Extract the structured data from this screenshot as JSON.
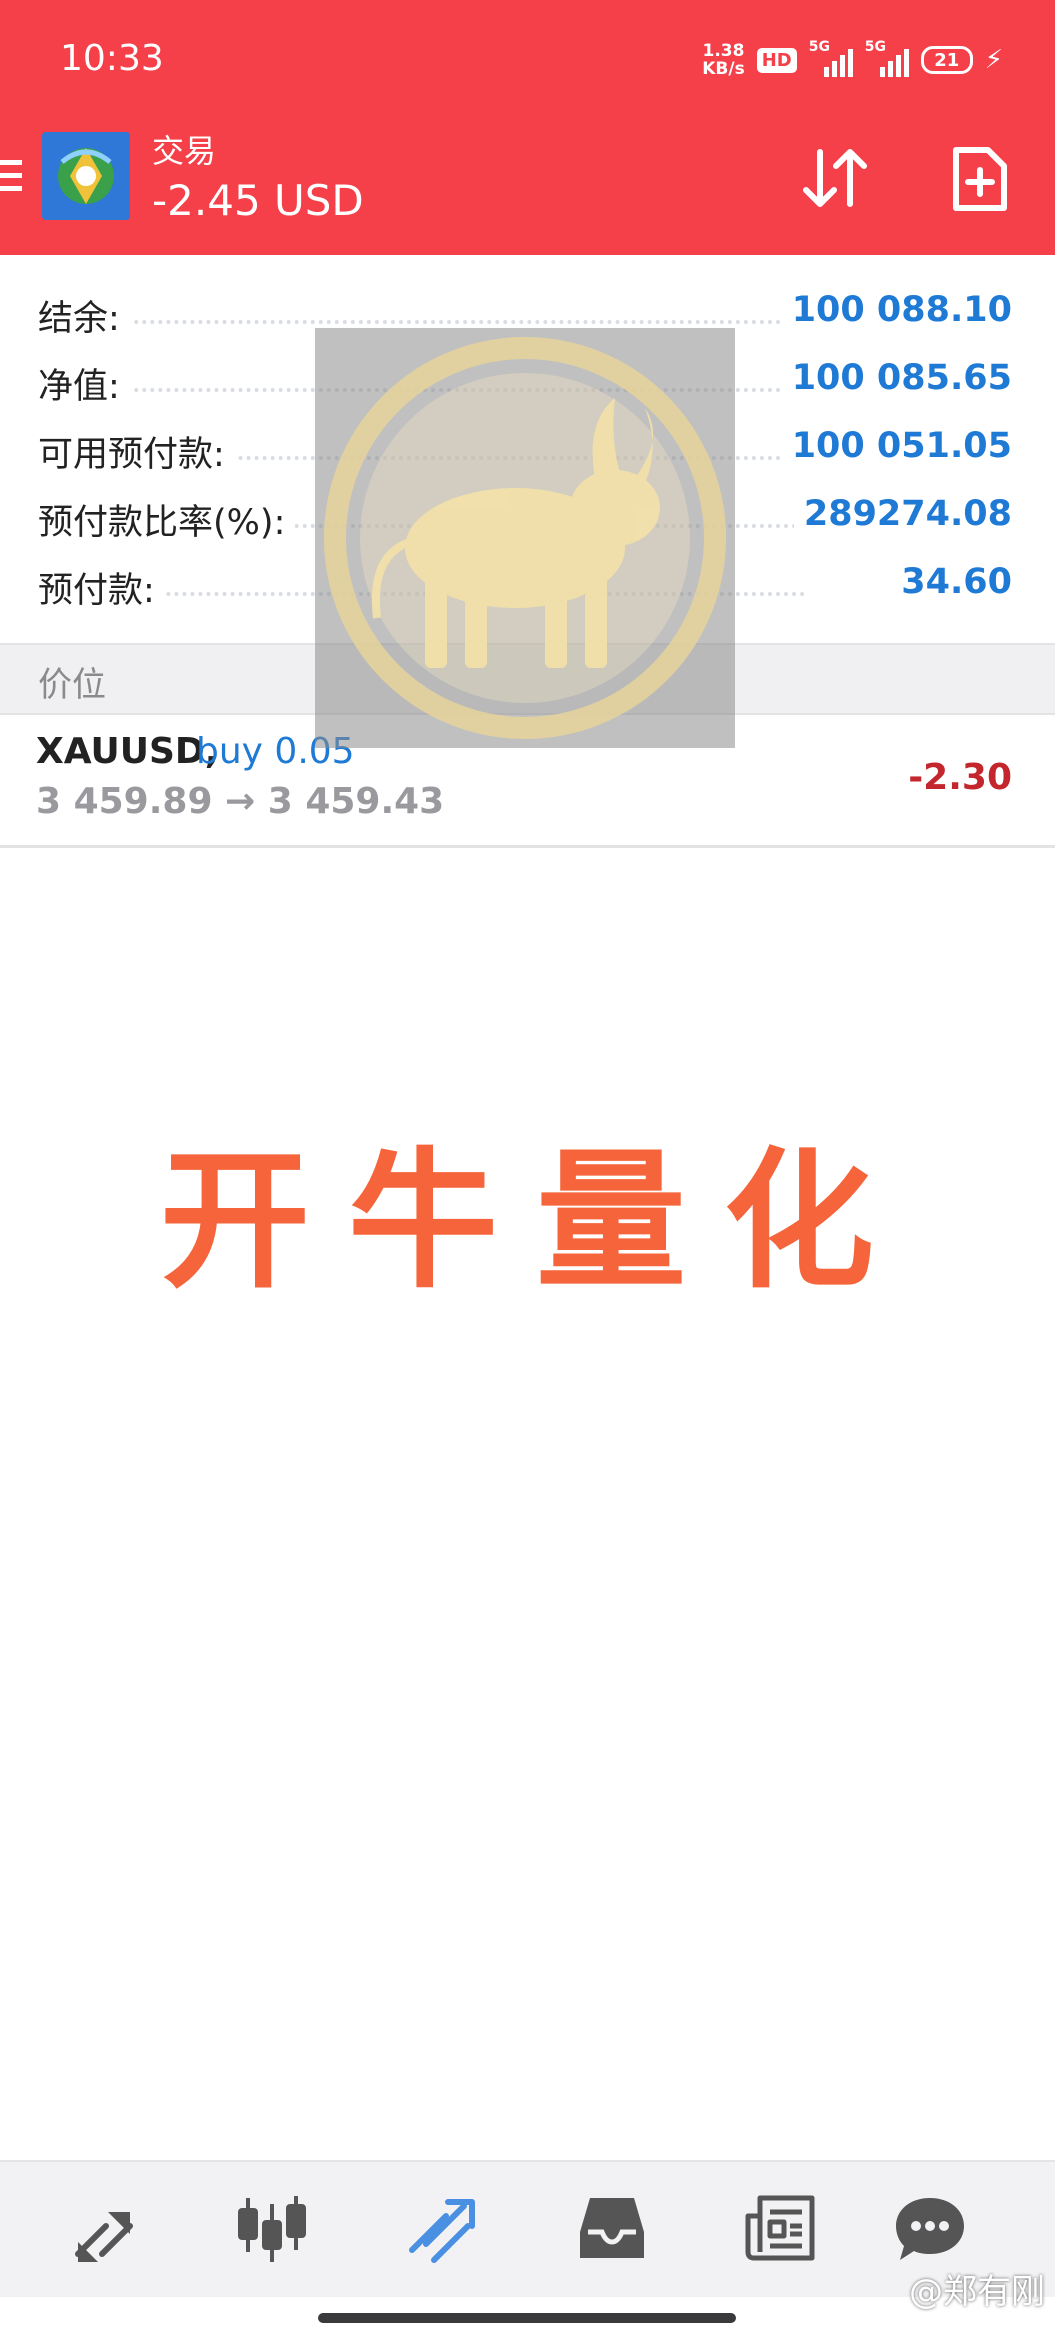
{
  "status_bar": {
    "time": "10:33",
    "net_speed_value": "1.38",
    "net_speed_unit": "KB/s",
    "hd_badge": "HD",
    "signal_1_label": "5G",
    "signal_2_label": "5G",
    "battery_level": "21"
  },
  "header": {
    "title": "交易",
    "profit": "-2.45 USD",
    "background_color": "#f5404a"
  },
  "summary": [
    {
      "label": "结余:",
      "value": "100 088.10"
    },
    {
      "label": "净值:",
      "value": "100 085.65"
    },
    {
      "label": "可用预付款:",
      "value": "100 051.05"
    },
    {
      "label": "预付款比率(%):",
      "value": "289274.08"
    },
    {
      "label": "预付款:",
      "value": "34.60"
    }
  ],
  "price_section": {
    "label": "价位"
  },
  "position": {
    "symbol": "XAUUSD,",
    "side": "buy 0.05",
    "prices": "3 459.89 → 3 459.43",
    "profit": "-2.30"
  },
  "watermark_text": "开牛量化",
  "bottom_nav": {
    "items": [
      "quotes-icon",
      "chart-icon",
      "trade-icon",
      "history-icon",
      "news-icon",
      "chat-icon"
    ],
    "active": "trade-icon",
    "accent_color": "#4a90e2"
  },
  "signature": "@郑有刚"
}
